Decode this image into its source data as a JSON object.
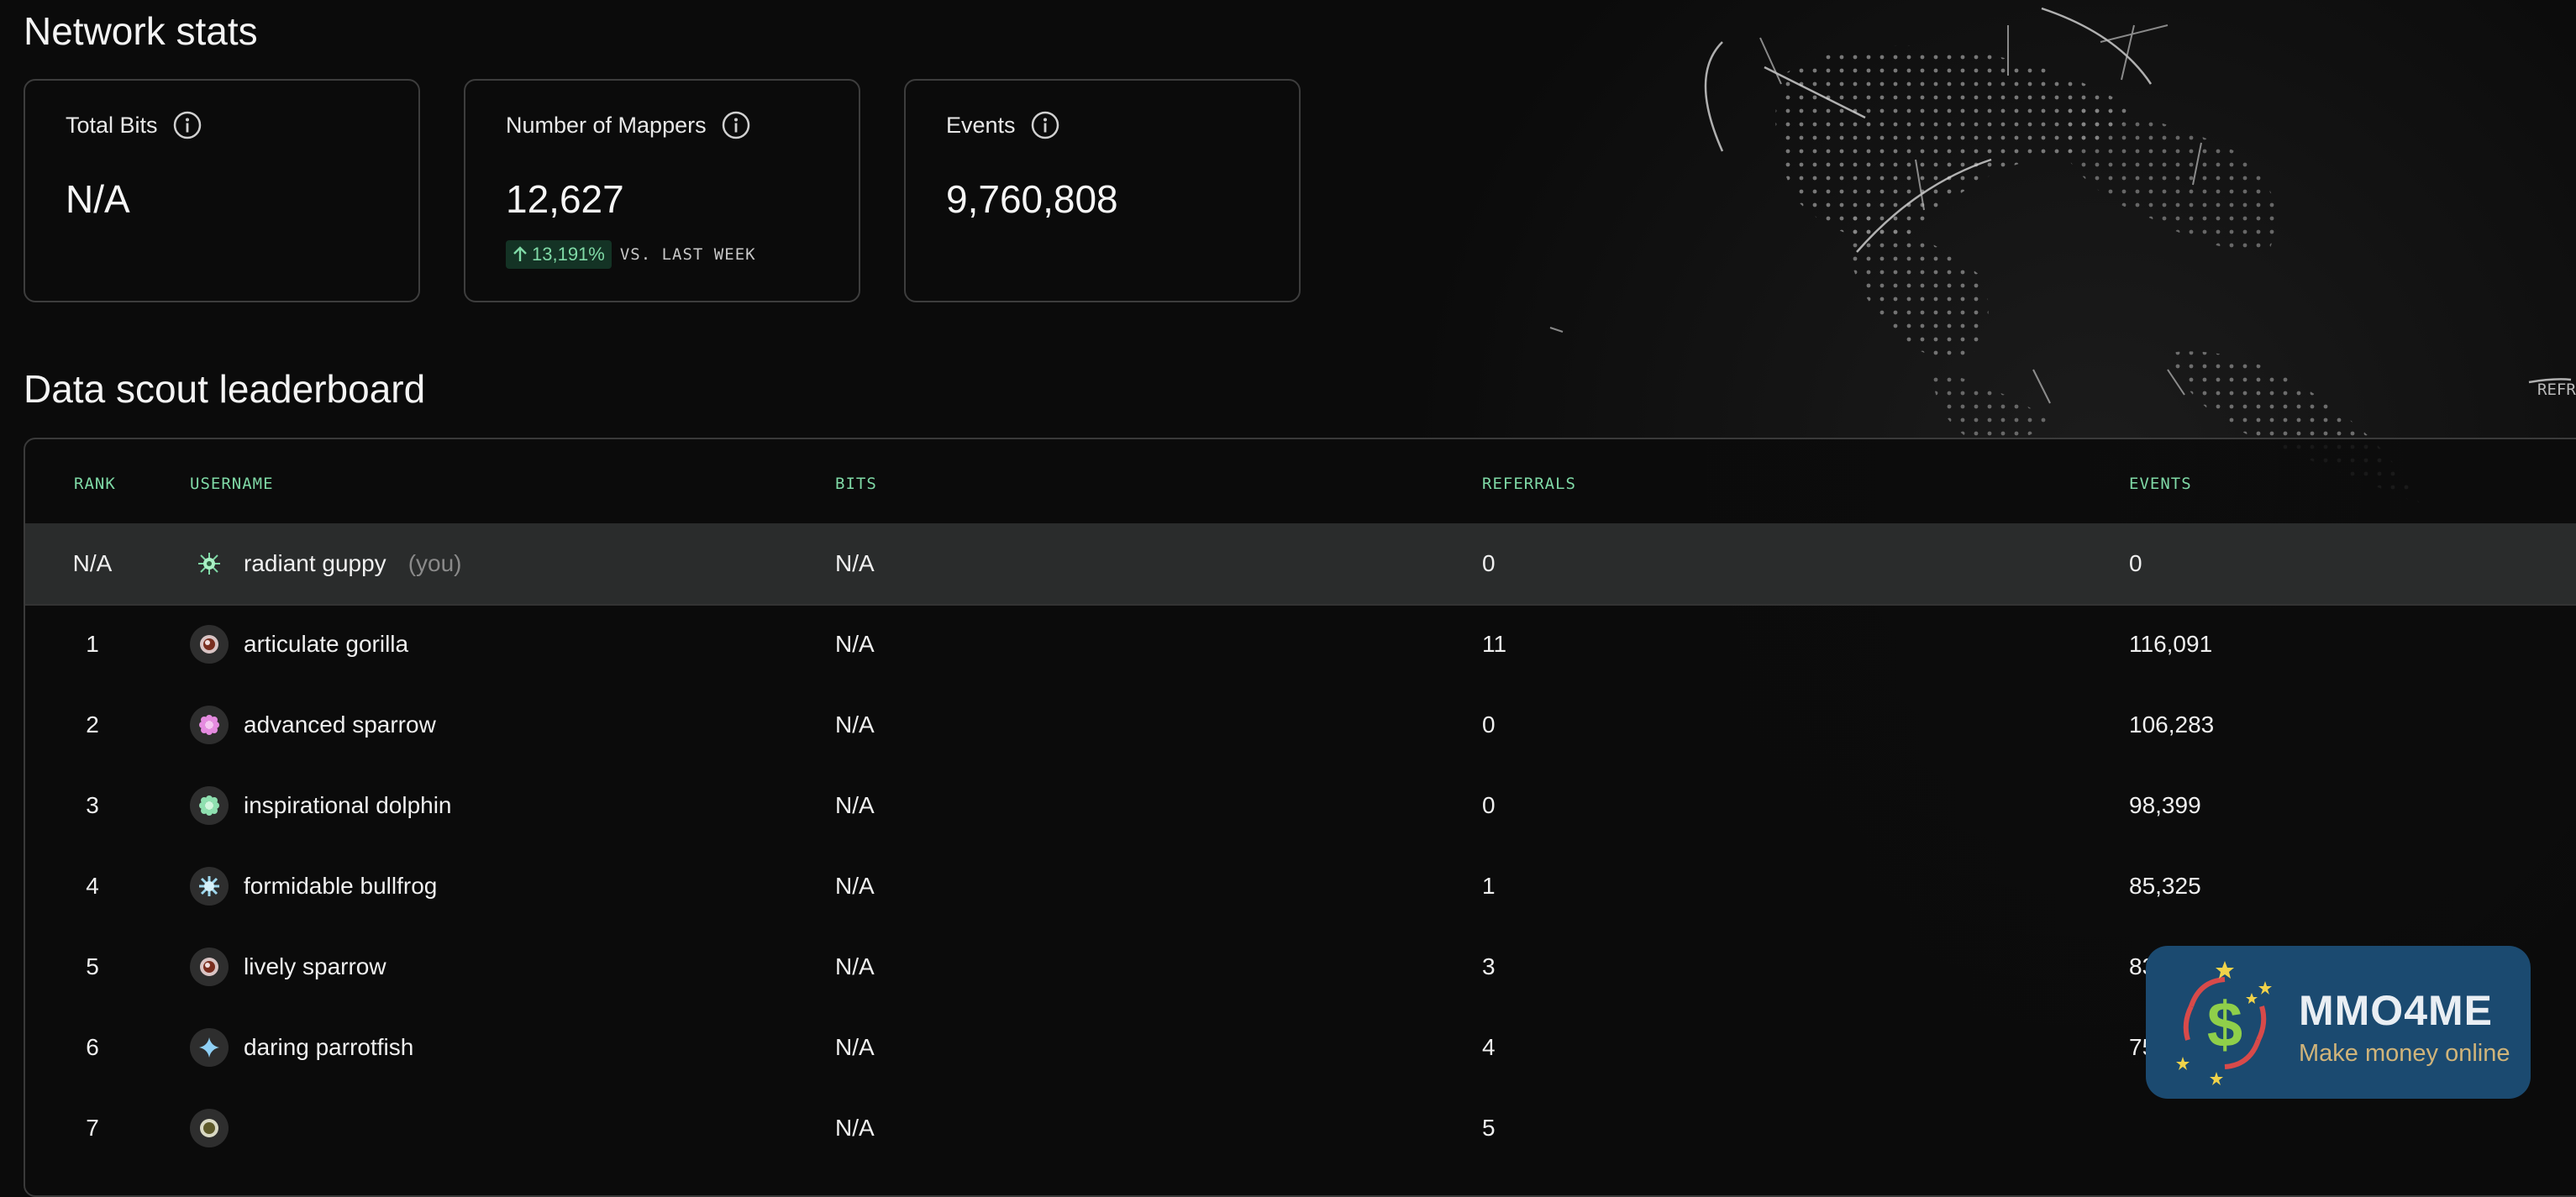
{
  "page": {
    "network_title": "Network stats",
    "leaderboard_title": "Data scout leaderboard",
    "side_label": "REFR"
  },
  "stats": [
    {
      "label": "Total Bits",
      "value": "N/A"
    },
    {
      "label": "Number of Mappers",
      "value": "12,627",
      "delta": "13,191%",
      "delta_suffix": "VS. LAST WEEK"
    },
    {
      "label": "Events",
      "value": "9,760,808"
    }
  ],
  "table": {
    "headers": {
      "rank": "RANK",
      "username": "USERNAME",
      "bits": "BITS",
      "referrals": "REFERRALS",
      "events": "EVENTS"
    },
    "you_tag": "(you)",
    "rows": [
      {
        "rank": "N/A",
        "username": "radiant guppy",
        "bits": "N/A",
        "referrals": "0",
        "events": "0",
        "avatar": "green-burst-icon"
      },
      {
        "rank": "1",
        "username": "articulate gorilla",
        "bits": "N/A",
        "referrals": "11",
        "events": "116,091",
        "avatar": "orb-icon"
      },
      {
        "rank": "2",
        "username": "advanced sparrow",
        "bits": "N/A",
        "referrals": "0",
        "events": "106,283",
        "avatar": "pink-flower-icon"
      },
      {
        "rank": "3",
        "username": "inspirational dolphin",
        "bits": "N/A",
        "referrals": "0",
        "events": "98,399",
        "avatar": "green-flower-icon"
      },
      {
        "rank": "4",
        "username": "formidable bullfrog",
        "bits": "N/A",
        "referrals": "1",
        "events": "85,325",
        "avatar": "blue-burst-icon"
      },
      {
        "rank": "5",
        "username": "lively sparrow",
        "bits": "N/A",
        "referrals": "3",
        "events": "83,159",
        "avatar": "orb-icon"
      },
      {
        "rank": "6",
        "username": "daring parrotfish",
        "bits": "N/A",
        "referrals": "4",
        "events": "75,9",
        "avatar": "blue-star-icon"
      },
      {
        "rank": "7",
        "username": "",
        "bits": "N/A",
        "referrals": "5",
        "events": "",
        "avatar": "orb-icon"
      }
    ]
  },
  "promo": {
    "name": "MMO4ME",
    "tagline": "Make money online"
  },
  "colors": {
    "accent": "#7fd9a6",
    "background": "#0b0b0b",
    "border": "#3d3d3d",
    "highlight_row": "#2a2c2c",
    "promo_bg": "#1b4a70",
    "promo_tag": "#d0b47a"
  }
}
